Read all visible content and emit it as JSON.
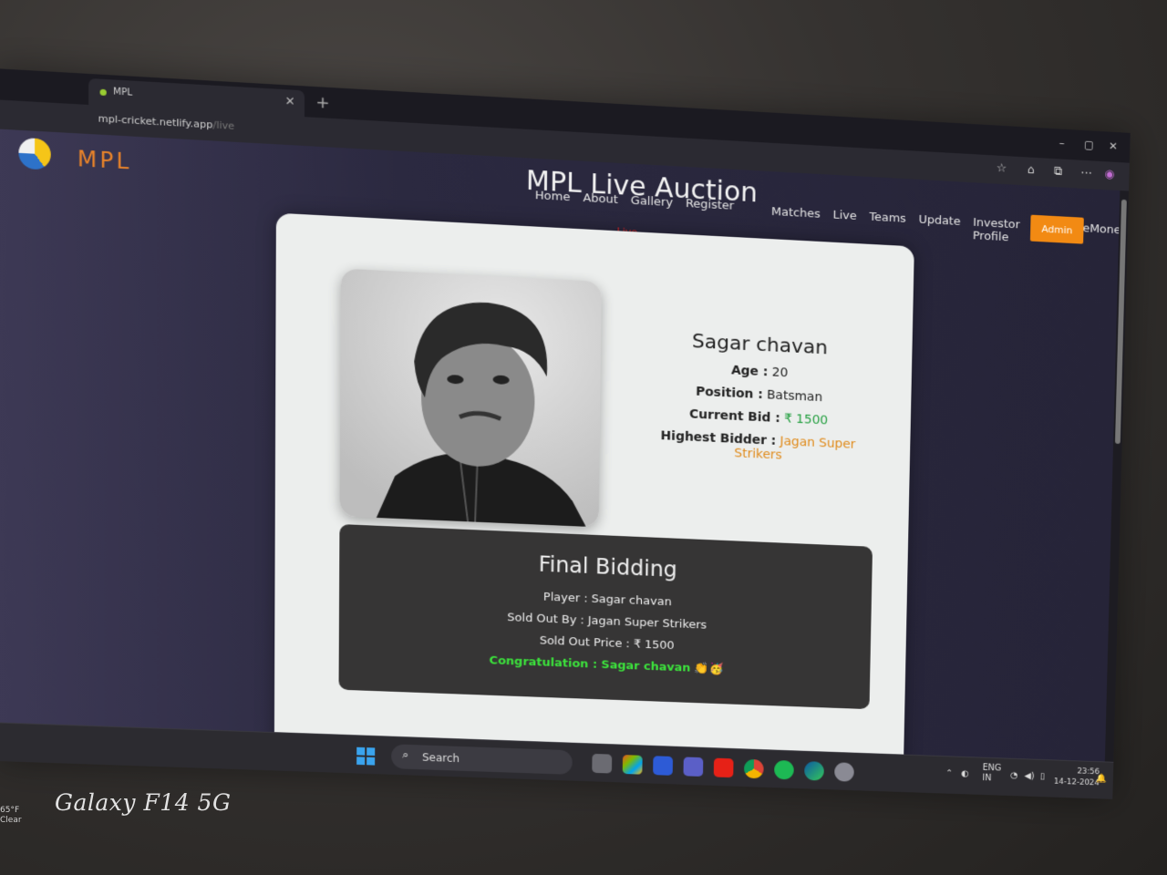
{
  "browser": {
    "tab_title": "MPL",
    "url": "mpl-cricket.netlify.app",
    "url_path": "/live"
  },
  "site": {
    "brand": "MPL",
    "page_title": "MPL Live Auction",
    "nav": [
      "Home",
      "About",
      "Gallery",
      "Register"
    ],
    "nav2": [
      "Matches",
      "Live",
      "Teams",
      "Update",
      "Investor Profile",
      "PriceMoney"
    ],
    "admin_label": "Admin",
    "live_label": "Live"
  },
  "player": {
    "name": "Sagar chavan",
    "age_label": "Age :",
    "age": "20",
    "position_label": "Position :",
    "position": "Batsman",
    "bid_label": "Current Bid :",
    "bid": "₹ 1500",
    "bidder_label": "Highest Bidder :",
    "bidder": "Jagan Super Strikers"
  },
  "final": {
    "title": "Final Bidding",
    "player_line": "Player : Sagar chavan",
    "sold_by_line": "Sold Out By : Jagan Super Strikers",
    "sold_price_line": "Sold Out Price : ₹ 1500",
    "congrats_line": "Congratulation : Sagar chavan 👏🥳"
  },
  "taskbar": {
    "search": "Search",
    "lang": "ENG",
    "region": "IN",
    "time": "23:56",
    "date": "14-12-2024"
  },
  "weather": {
    "temp": "65°F",
    "cond": "Clear"
  },
  "watermark": "Galaxy F14 5G",
  "colors": {
    "accent": "#f28a13",
    "bid_green": "#26a042",
    "bidder_orange": "#e08a19",
    "congrats_green": "#3ce33c",
    "live_red": "#e02b2b"
  }
}
